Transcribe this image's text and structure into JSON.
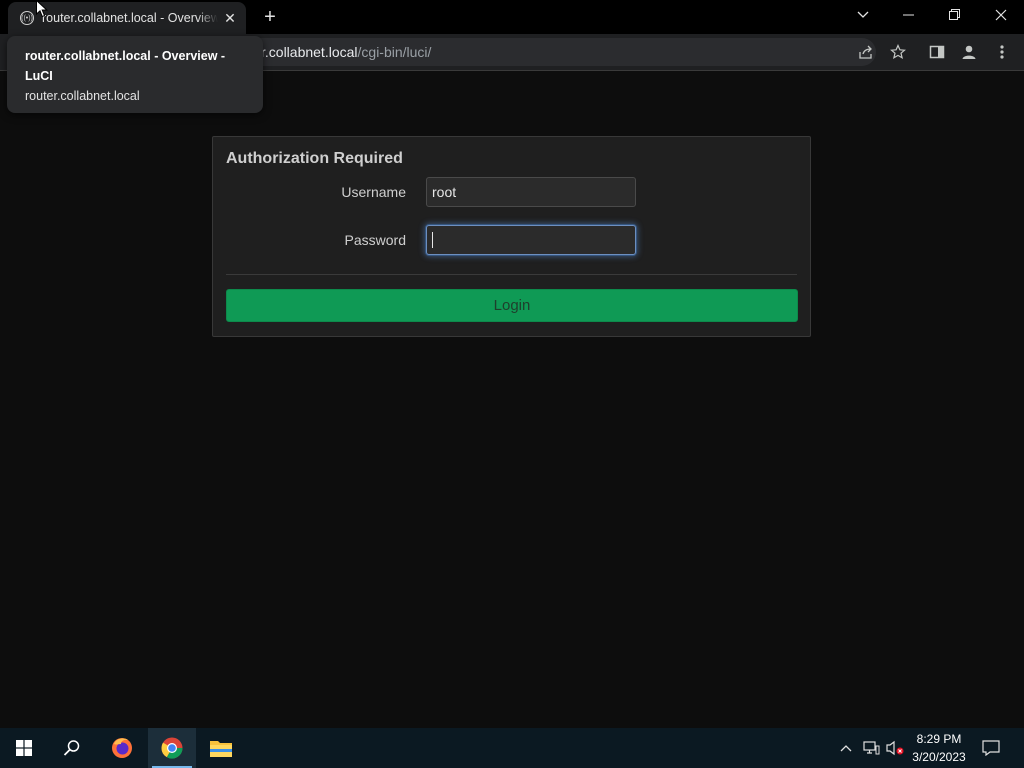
{
  "browser": {
    "tab_title": "router.collabnet.local - Overview",
    "tab_favicon": "openwrt-icon",
    "address_host_part": "r.collabnet.local",
    "address_path": "/cgi-bin/luci/"
  },
  "tooltip": {
    "title": "router.collabnet.local - Overview - LuCI",
    "host": "router.collabnet.local"
  },
  "login": {
    "heading": "Authorization Required",
    "username_label": "Username",
    "username_value": "root",
    "password_label": "Password",
    "password_value": "",
    "login_button": "Login"
  },
  "taskbar": {
    "time": "8:29 PM",
    "date": "3/20/2023",
    "apps": [
      "windows-start-icon",
      "search-icon",
      "firefox-icon",
      "chrome-icon",
      "file-explorer-icon"
    ]
  },
  "colors": {
    "page_bg": "#0d0d0d",
    "login_button": "#0f9a55",
    "focus_ring": "#6d8fbf"
  }
}
